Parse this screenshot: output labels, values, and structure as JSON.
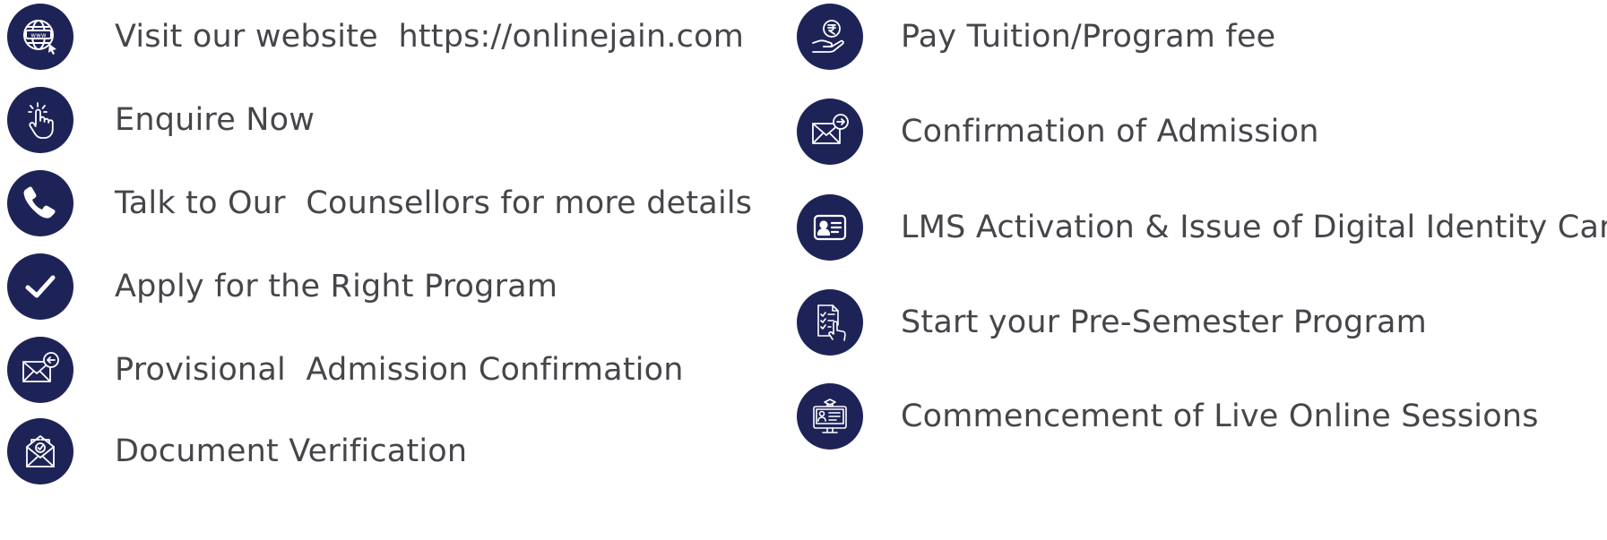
{
  "colors": {
    "icon_background": "#1e2357",
    "icon_stroke": "#ffffff",
    "text": "#45464a"
  },
  "steps_left": [
    {
      "label": "Visit our website  https://onlinejain.com",
      "icon": "globe-cursor-icon"
    },
    {
      "label": "Enquire Now",
      "icon": "tap-hand-icon"
    },
    {
      "label": "Talk to Our  Counsellors for more details",
      "icon": "phone-icon"
    },
    {
      "label": "Apply for the Right Program",
      "icon": "checkmark-icon"
    },
    {
      "label": "Provisional  Admission Confirmation",
      "icon": "mail-return-icon"
    },
    {
      "label": "Document Verification",
      "icon": "document-verified-icon"
    }
  ],
  "steps_right": [
    {
      "label": "Pay Tuition/Program fee",
      "icon": "rupee-payment-icon"
    },
    {
      "label": "Confirmation of Admission",
      "icon": "mail-forward-icon"
    },
    {
      "label": "LMS Activation & Issue of Digital Identity Card",
      "icon": "id-card-icon"
    },
    {
      "label": "Start your Pre-Semester Program",
      "icon": "checklist-hand-icon"
    },
    {
      "label": "Commencement of Live Online Sessions",
      "icon": "online-class-icon"
    }
  ]
}
